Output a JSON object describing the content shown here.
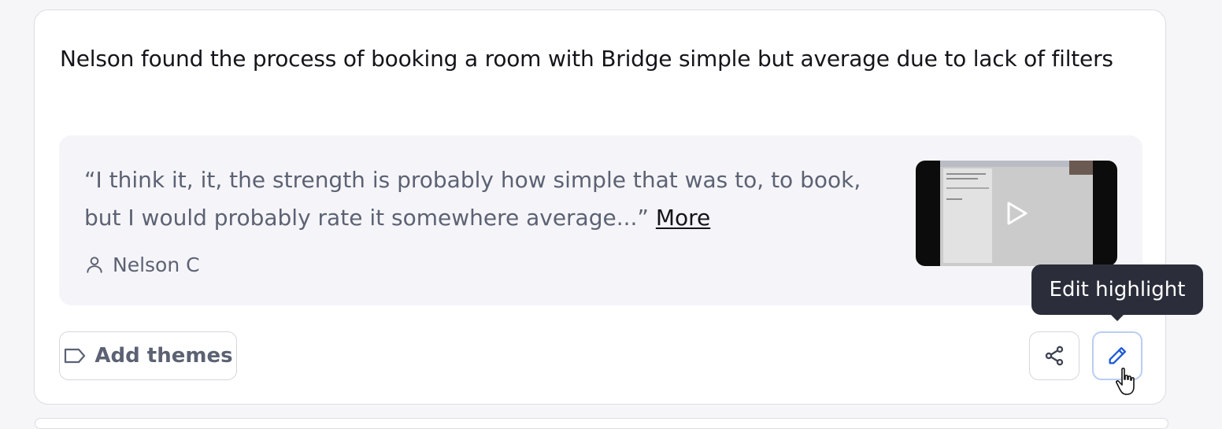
{
  "highlight": {
    "title": "Nelson found the process of booking a room with Bridge simple but average due to lack of filters",
    "quote": "“I think it, it, the strength is probably how simple that was to, to book, but I would probably rate it somewhere average...”",
    "more_label": "More",
    "speaker": "Nelson C"
  },
  "video_thumbnail": {
    "icon": "play-icon"
  },
  "actions": {
    "add_themes_label": "Add themes",
    "share_icon": "share-icon",
    "edit_icon": "pencil-icon"
  },
  "tooltip": {
    "text": "Edit highlight"
  },
  "colors": {
    "accent": "#1f5bd6",
    "tooltip_bg": "#2b2e3a",
    "quote_bg": "#f5f5f9",
    "muted_text": "#5c6273"
  }
}
